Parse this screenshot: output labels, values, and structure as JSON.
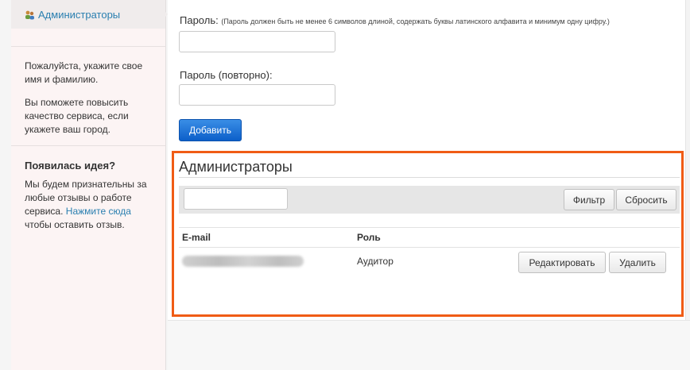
{
  "sidebar": {
    "active_item": {
      "label": "Администраторы",
      "icon": "users-icon"
    },
    "profile_hint_1": "Пожалуйста, укажите свое имя и фамилию.",
    "profile_hint_2": "Вы поможете повысить качество сервиса, если укажете ваш город.",
    "idea_heading": "Появилась идея?",
    "idea_text_before": "Мы будем признательны за любые отзывы о работе сервиса.",
    "idea_link": "Нажмите сюда",
    "idea_text_after": "чтобы оставить отзыв."
  },
  "form": {
    "password_label": "Пароль:",
    "password_hint": "(Пароль должен быть не менее 6 символов длиной, содержать буквы латинского алфавита и минимум одну цифру.)",
    "password_value": "",
    "password_repeat_label": "Пароль (повторно):",
    "password_repeat_value": "",
    "add_button": "Добавить"
  },
  "admins": {
    "title": "Администраторы",
    "filter_value": "",
    "filter_button": "Фильтр",
    "reset_button": "Сбросить",
    "columns": [
      "E-mail",
      "Роль"
    ],
    "rows": [
      {
        "email_redacted": true,
        "role": "Аудитор",
        "edit_button": "Редактировать",
        "delete_button": "Удалить"
      }
    ]
  },
  "colors": {
    "link": "#2a7fb0",
    "primary_button": "#1565d0",
    "highlight_border": "#f05c15"
  }
}
